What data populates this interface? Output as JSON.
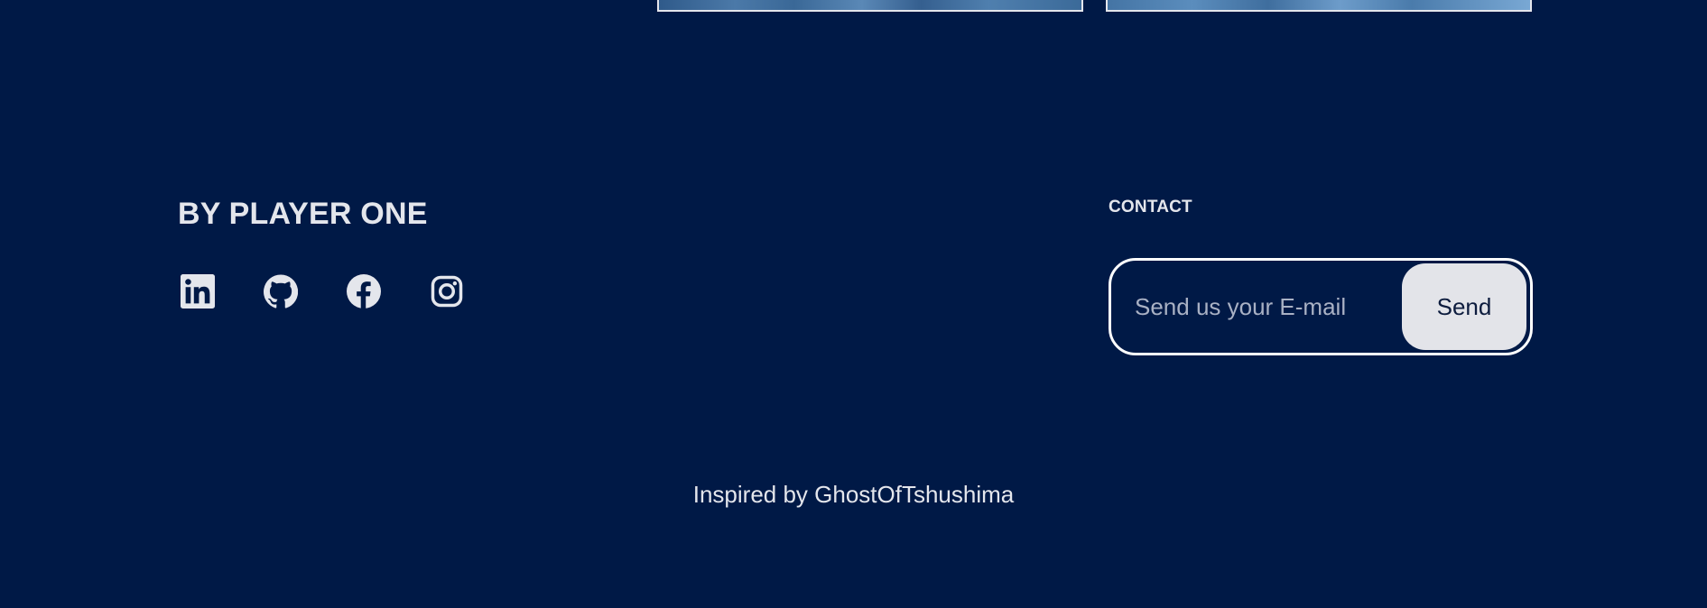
{
  "brand": {
    "title": "BY PLAYER ONE"
  },
  "social": [
    {
      "name": "LinkedIn",
      "icon": "linkedin-icon"
    },
    {
      "name": "GitHub",
      "icon": "github-icon"
    },
    {
      "name": "Facebook",
      "icon": "facebook-icon"
    },
    {
      "name": "Instagram",
      "icon": "instagram-icon"
    }
  ],
  "contact": {
    "heading": "CONTACT",
    "email_placeholder": "Send us your E-mail",
    "email_value": "",
    "send_label": "Send"
  },
  "footer": {
    "credit": "Inspired by GhostOfTshushima"
  },
  "colors": {
    "background": "#001946",
    "text": "#e4e6ec",
    "button_bg": "#e3e4e9",
    "button_text": "#0d1c3e",
    "border": "#ffffff"
  }
}
